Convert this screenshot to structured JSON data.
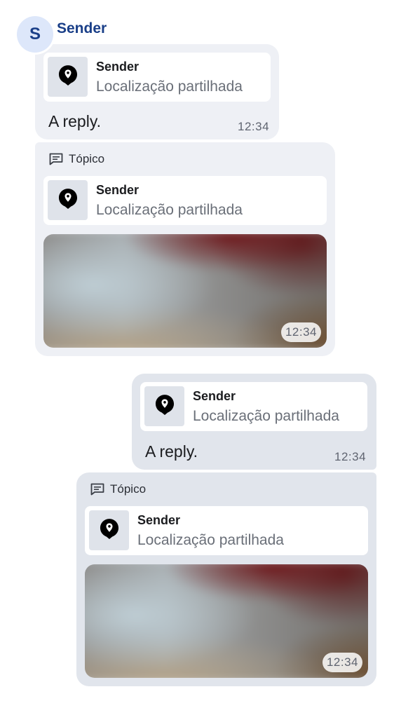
{
  "sender": {
    "avatar_letter": "S",
    "name": "Sender"
  },
  "messages": [
    {
      "quote": {
        "sender": "Sender",
        "text": "Localização partilhada"
      },
      "body": "A reply.",
      "time": "12:34"
    },
    {
      "thread_label": "Tópico",
      "quote": {
        "sender": "Sender",
        "text": "Localização partilhada"
      },
      "time": "12:34"
    },
    {
      "quote": {
        "sender": "Sender",
        "text": "Localização partilhada"
      },
      "body": "A reply.",
      "time": "12:34"
    },
    {
      "thread_label": "Tópico",
      "quote": {
        "sender": "Sender",
        "text": "Localização partilhada"
      },
      "time": "12:34"
    }
  ],
  "colors": {
    "sender_name": "#1a3f88",
    "incoming_bubble": "#eef0f5",
    "outgoing_bubble": "#e1e5ec"
  },
  "icons": {
    "location": "location-pin-icon",
    "thread": "thread-icon"
  }
}
